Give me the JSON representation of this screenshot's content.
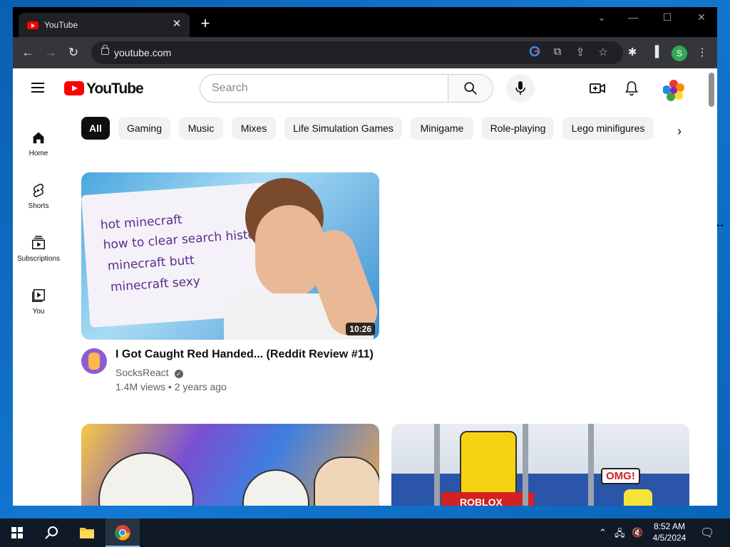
{
  "browser": {
    "tab_title": "YouTube",
    "url": "youtube.com",
    "profile_initial": "S"
  },
  "youtube": {
    "logo_text": "YouTube",
    "search_placeholder": "Search",
    "guide": [
      {
        "label": "Home",
        "icon": "home-icon"
      },
      {
        "label": "Shorts",
        "icon": "shorts-icon"
      },
      {
        "label": "Subscriptions",
        "icon": "subscriptions-icon"
      },
      {
        "label": "You",
        "icon": "library-icon"
      }
    ],
    "chips": [
      "All",
      "Gaming",
      "Music",
      "Mixes",
      "Life Simulation Games",
      "Minigame",
      "Role-playing",
      "Lego minifigures"
    ],
    "active_chip": "All",
    "videos": [
      {
        "title": "I Got Caught Red Handed... (Reddit Review #11)",
        "channel": "SocksReact",
        "verified": true,
        "meta": "1.4M views • 2 years ago",
        "duration": "10:26",
        "thumbnail_text": [
          "hot minecraft",
          "how to clear search history",
          "minecraft butt",
          "minecraft sexy"
        ]
      }
    ],
    "thumb2_text": "OMG!",
    "thumb2_brand": "ROBLOX"
  },
  "taskbar": {
    "time": "8:52 AM",
    "date": "4/5/2024"
  }
}
